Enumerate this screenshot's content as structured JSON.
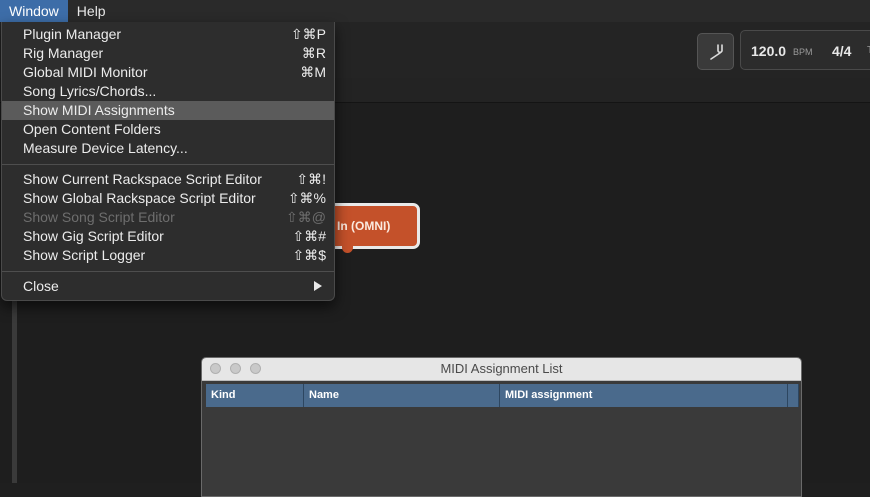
{
  "menubar": {
    "items": [
      {
        "label": "Window",
        "active": true
      },
      {
        "label": "Help",
        "active": false
      }
    ]
  },
  "toolbar": {
    "tuner_icon": "tuning-fork-icon",
    "tempo": "120.0",
    "tempo_unit": "BPM",
    "time_signature": "4/4",
    "tail_text": "T"
  },
  "canvas": {
    "midi_in_block_label": "In (OMNI)"
  },
  "window_menu": {
    "items": [
      {
        "label": "Plugin Manager",
        "shortcut": "⇧⌘P",
        "enabled": true,
        "highlighted": false
      },
      {
        "label": "Rig Manager",
        "shortcut": "⌘R",
        "enabled": true,
        "highlighted": false
      },
      {
        "label": "Global MIDI Monitor",
        "shortcut": "⌘M",
        "enabled": true,
        "highlighted": false
      },
      {
        "label": "Song Lyrics/Chords...",
        "shortcut": "",
        "enabled": true,
        "highlighted": false
      },
      {
        "label": "Show MIDI Assignments",
        "shortcut": "",
        "enabled": true,
        "highlighted": true
      },
      {
        "label": "Open Content Folders",
        "shortcut": "",
        "enabled": true,
        "highlighted": false
      },
      {
        "label": "Measure Device Latency...",
        "shortcut": "",
        "enabled": true,
        "highlighted": false
      },
      {
        "label": "Show Current Rackspace Script Editor",
        "shortcut": "⇧⌘!",
        "enabled": true,
        "highlighted": false
      },
      {
        "label": "Show Global Rackspace Script Editor",
        "shortcut": "⇧⌘%",
        "enabled": true,
        "highlighted": false
      },
      {
        "label": "Show Song Script Editor",
        "shortcut": "⇧⌘@",
        "enabled": false,
        "highlighted": false
      },
      {
        "label": "Show Gig Script Editor",
        "shortcut": "⇧⌘#",
        "enabled": true,
        "highlighted": false
      },
      {
        "label": "Show Script Logger",
        "shortcut": "⇧⌘$",
        "enabled": true,
        "highlighted": false
      },
      {
        "label": "Close",
        "shortcut": "",
        "enabled": true,
        "highlighted": false,
        "submenu": true
      }
    ]
  },
  "midi_assignment_window": {
    "title": "MIDI Assignment List",
    "columns": [
      "Kind",
      "Name",
      "MIDI assignment"
    ],
    "rows": []
  },
  "colors": {
    "menu_highlight": "#5b5b5b",
    "menubar_active": "#3d6da8",
    "block_orange": "#c4512a",
    "table_header": "#4a6a8c"
  }
}
